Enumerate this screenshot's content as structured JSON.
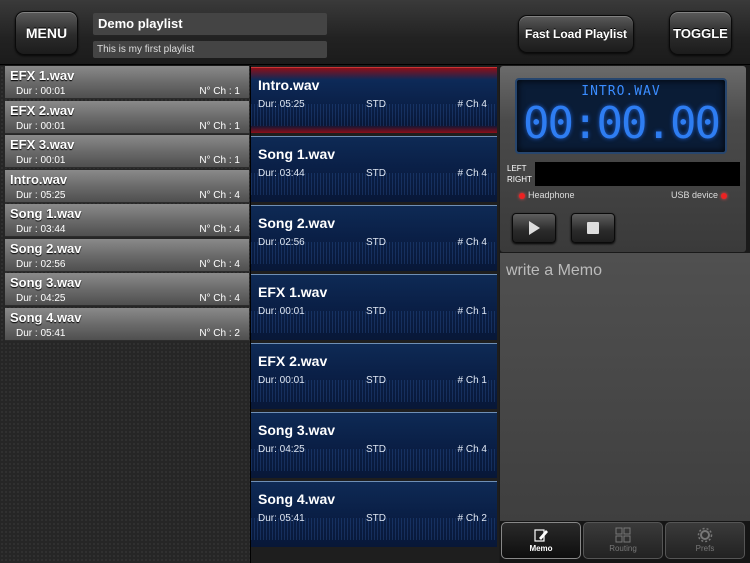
{
  "header": {
    "menu_label": "MENU",
    "playlist_title": "Demo playlist",
    "playlist_description": "This is my first playlist",
    "fast_load_label": "Fast Load Playlist",
    "toggle_label": "TOGGLE"
  },
  "library": [
    {
      "name": "EFX 1.wav",
      "dur": "Dur : 00:01",
      "ch": "N° Ch : 1"
    },
    {
      "name": "EFX 2.wav",
      "dur": "Dur : 00:01",
      "ch": "N° Ch : 1"
    },
    {
      "name": "EFX 3.wav",
      "dur": "Dur : 00:01",
      "ch": "N° Ch : 1"
    },
    {
      "name": "Intro.wav",
      "dur": "Dur : 05:25",
      "ch": "N° Ch : 4"
    },
    {
      "name": "Song 1.wav",
      "dur": "Dur : 03:44",
      "ch": "N° Ch : 4"
    },
    {
      "name": "Song 2.wav",
      "dur": "Dur : 02:56",
      "ch": "N° Ch : 4"
    },
    {
      "name": "Song 3.wav",
      "dur": "Dur : 04:25",
      "ch": "N° Ch : 4"
    },
    {
      "name": "Song 4.wav",
      "dur": "Dur : 05:41",
      "ch": "N° Ch : 2"
    }
  ],
  "playlist": [
    {
      "name": "Intro.wav",
      "dur": "Dur: 05:25",
      "type": "STD",
      "ch": "# Ch 4"
    },
    {
      "name": "Song 1.wav",
      "dur": "Dur: 03:44",
      "type": "STD",
      "ch": "# Ch 4"
    },
    {
      "name": "Song 2.wav",
      "dur": "Dur: 02:56",
      "type": "STD",
      "ch": "# Ch 4"
    },
    {
      "name": "EFX 1.wav",
      "dur": "Dur: 00:01",
      "type": "STD",
      "ch": "# Ch 1"
    },
    {
      "name": "EFX 2.wav",
      "dur": "Dur: 00:01",
      "type": "STD",
      "ch": "# Ch 1"
    },
    {
      "name": "Song 3.wav",
      "dur": "Dur: 04:25",
      "type": "STD",
      "ch": "# Ch 4"
    },
    {
      "name": "Song 4.wav",
      "dur": "Dur: 05:41",
      "type": "STD",
      "ch": "# Ch 2"
    }
  ],
  "player": {
    "current_file": "INTRO.WAV",
    "time": "00:00.00",
    "left_label": "LEFT",
    "right_label": "RIGHT",
    "headphone_label": "Headphone",
    "usb_label": "USB device",
    "play_icon": "play-icon",
    "stop_icon": "stop-icon"
  },
  "memo": {
    "placeholder": "write a Memo"
  },
  "tabs": [
    {
      "label": "Memo",
      "icon": "memo-icon",
      "active": true
    },
    {
      "label": "Routing",
      "icon": "routing-icon",
      "active": false
    },
    {
      "label": "Prefs",
      "icon": "gear-icon",
      "active": false
    }
  ],
  "colors": {
    "lcd_text": "#2e7df2",
    "active_track": "#8a0f18",
    "playlist_row": "#0a1f46",
    "led": "#e22222"
  }
}
